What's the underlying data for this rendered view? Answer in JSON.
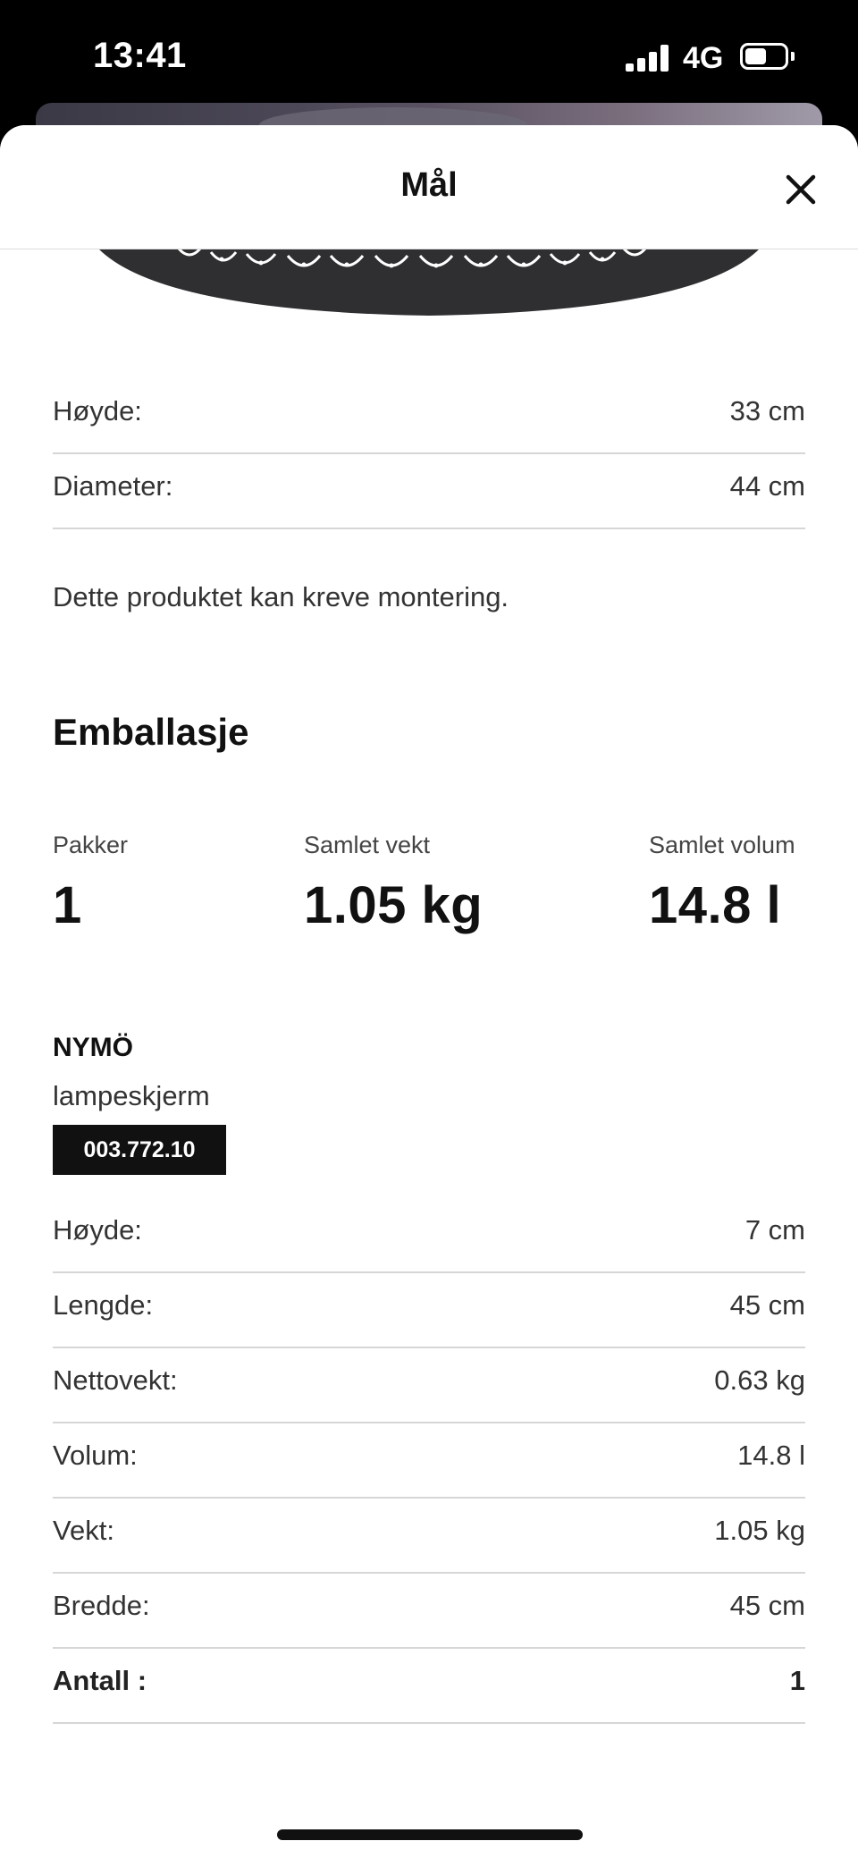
{
  "status_bar": {
    "time": "13:41",
    "network": "4G",
    "battery_level": 0.55
  },
  "sheet": {
    "title": "Mål"
  },
  "dimensions": [
    {
      "label": "Høyde:",
      "value": "33 cm"
    },
    {
      "label": "Diameter:",
      "value": "44 cm"
    }
  ],
  "note": "Dette produktet kan kreve montering.",
  "packaging": {
    "title": "Emballasje",
    "stats": [
      {
        "label": "Pakker",
        "value": "1"
      },
      {
        "label": "Samlet vekt",
        "value": "1.05 kg"
      },
      {
        "label": "Samlet volum",
        "value": "14.8 l"
      }
    ]
  },
  "product": {
    "name": "NYMÖ",
    "type": "lampeskjerm",
    "article_number": "003.772.10",
    "details": [
      {
        "label": "Høyde:",
        "value": "7 cm"
      },
      {
        "label": "Lengde:",
        "value": "45 cm"
      },
      {
        "label": "Nettovekt:",
        "value": "0.63 kg"
      },
      {
        "label": "Volum:",
        "value": "14.8 l"
      },
      {
        "label": "Vekt:",
        "value": "1.05 kg"
      },
      {
        "label": "Bredde:",
        "value": "45 cm"
      },
      {
        "label": "Antall :",
        "value": "1"
      }
    ]
  },
  "icons": {
    "close": "close-icon",
    "signal": "signal-icon",
    "battery": "battery-icon"
  }
}
